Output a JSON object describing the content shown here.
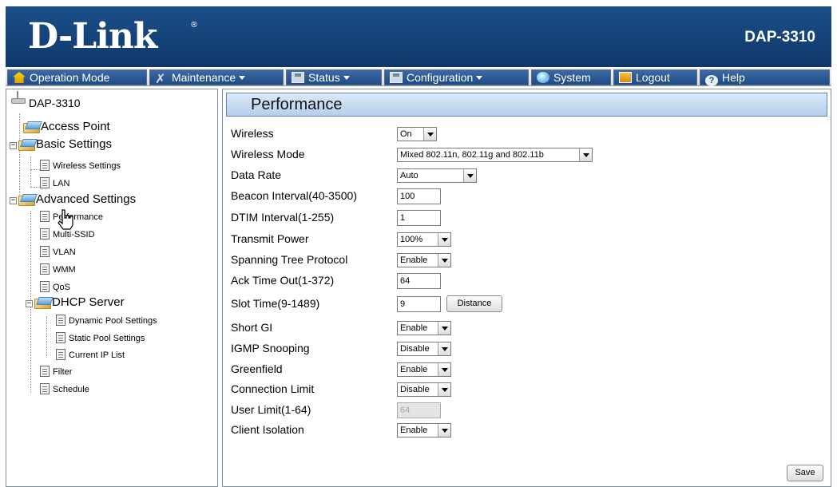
{
  "header": {
    "logo": "D-Link",
    "logo_mark": "®",
    "model": "DAP-3310"
  },
  "menu": [
    {
      "label": "Operation Mode",
      "icon": "home-icon",
      "dropdown": false
    },
    {
      "label": "Maintenance",
      "icon": "tools-icon",
      "dropdown": true
    },
    {
      "label": "Status",
      "icon": "disk-icon",
      "dropdown": true
    },
    {
      "label": "Configuration",
      "icon": "disk-icon",
      "dropdown": true
    },
    {
      "label": "System",
      "icon": "globe-icon",
      "dropdown": false
    },
    {
      "label": "Logout",
      "icon": "logout-icon",
      "dropdown": false
    },
    {
      "label": "Help",
      "icon": "help-icon",
      "dropdown": false
    }
  ],
  "tree": {
    "root": "DAP-3310",
    "access_point": "Access Point",
    "basic_settings": "Basic Settings",
    "wireless_settings": "Wireless Settings",
    "lan": "LAN",
    "advanced_settings": "Advanced Settings",
    "performance": "Performance",
    "multi_ssid": "Multi-SSID",
    "vlan": "VLAN",
    "wmm": "WMM",
    "qos": "QoS",
    "dhcp_server": "DHCP Server",
    "dynamic_pool": "Dynamic Pool Settings",
    "static_pool": "Static Pool Settings",
    "current_ip_list": "Current IP List",
    "filter": "Filter",
    "schedule": "Schedule"
  },
  "panel": {
    "title": "Performance",
    "fields": {
      "wireless": {
        "label": "Wireless",
        "value": "On"
      },
      "wireless_mode": {
        "label": "Wireless Mode",
        "value": "Mixed 802.11n, 802.11g and 802.11b"
      },
      "data_rate": {
        "label": "Data Rate",
        "value": "Auto"
      },
      "beacon_interval": {
        "label": "Beacon Interval(40-3500)",
        "value": "100"
      },
      "dtim_interval": {
        "label": "DTIM Interval(1-255)",
        "value": "1"
      },
      "transmit_power": {
        "label": "Transmit Power",
        "value": "100%"
      },
      "stp": {
        "label": "Spanning Tree Protocol",
        "value": "Enable"
      },
      "ack_timeout": {
        "label": "Ack Time Out(1-372)",
        "value": "64"
      },
      "slot_time": {
        "label": "Slot Time(9-1489)",
        "value": "9",
        "button": "Distance"
      },
      "short_gi": {
        "label": "Short GI",
        "value": "Enable"
      },
      "igmp": {
        "label": "IGMP Snooping",
        "value": "Disable"
      },
      "greenfield": {
        "label": "Greenfield",
        "value": "Enable"
      },
      "conn_limit": {
        "label": "Connection Limit",
        "value": "Disable"
      },
      "user_limit": {
        "label": "User Limit(1-64)",
        "value": "64"
      },
      "client_isolation": {
        "label": "Client Isolation",
        "value": "Enable"
      }
    },
    "save": "Save"
  }
}
